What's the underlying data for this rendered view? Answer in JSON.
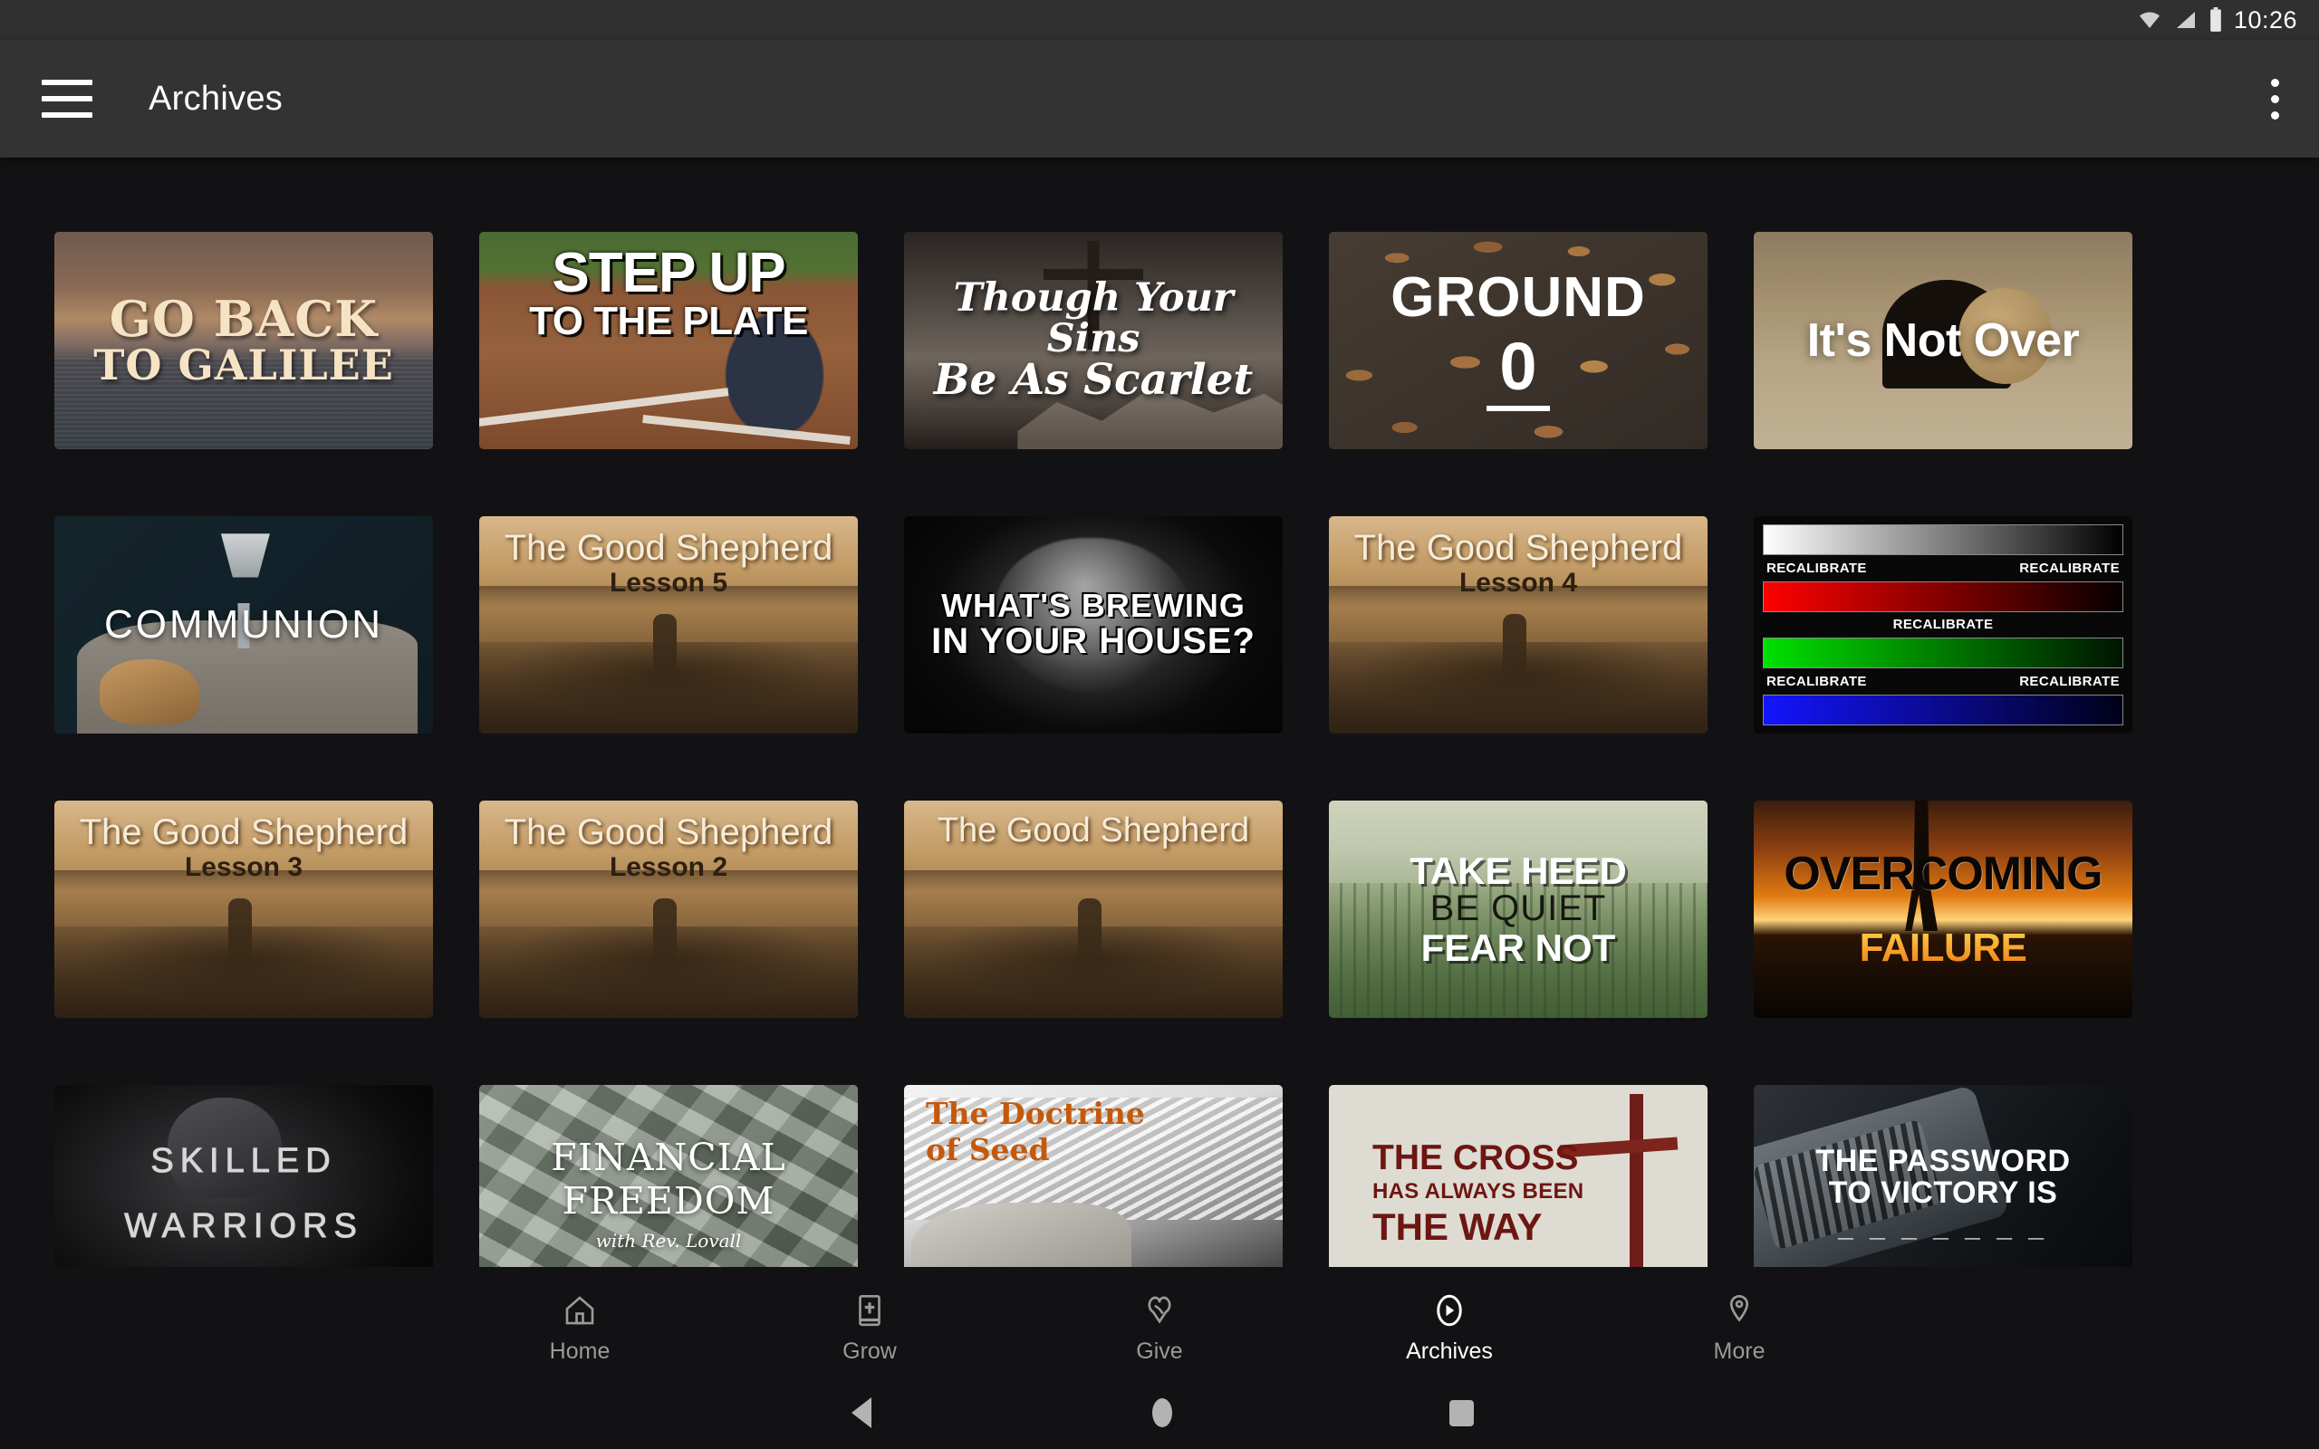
{
  "status_bar": {
    "time": "10:26",
    "icons": [
      "wifi-icon",
      "cell-signal-icon",
      "battery-icon"
    ]
  },
  "app_bar": {
    "menu_icon": "hamburger-menu-icon",
    "title": "Archives",
    "overflow_icon": "overflow-menu-icon"
  },
  "grid": {
    "tiles": [
      {
        "id": "go-back-to-galilee",
        "lines": [
          "GO BACK",
          "TO GALILEE"
        ],
        "style": "sunset lake, cream serif text"
      },
      {
        "id": "step-up-to-the-plate",
        "lines": [
          "STEP UP",
          "TO THE PLATE"
        ],
        "style": "baseball home plate"
      },
      {
        "id": "though-your-sins-be-as-scarlet",
        "lines": [
          "Though Your Sins",
          "Be As Scarlet"
        ],
        "style": "cross on rocky hill, script"
      },
      {
        "id": "ground-0",
        "lines": [
          "GROUND",
          "0"
        ],
        "style": "leaves on soil"
      },
      {
        "id": "its-not-over",
        "lines": [
          "It's Not Over"
        ],
        "style": "empty tomb"
      },
      {
        "id": "communion",
        "lines": [
          "COMMUNION"
        ],
        "style": "chalice and bread"
      },
      {
        "id": "the-good-shepherd-lesson-5",
        "lines": [
          "The Good Shepherd",
          "Lesson 5"
        ],
        "style": "sepia shepherd and flock"
      },
      {
        "id": "whats-brewing-in-your-house",
        "lines": [
          "WHAT'S BREWING",
          "IN YOUR HOUSE?"
        ],
        "style": "smoky brain on black"
      },
      {
        "id": "the-good-shepherd-lesson-4",
        "lines": [
          "The Good Shepherd",
          "Lesson 4"
        ],
        "style": "sepia shepherd and flock"
      },
      {
        "id": "recalibrate",
        "lines": [
          "RECALIBRATE"
        ],
        "style": "color calibration bars"
      },
      {
        "id": "the-good-shepherd-lesson-3",
        "lines": [
          "The Good Shepherd",
          "Lesson 3"
        ],
        "style": "sepia shepherd and flock"
      },
      {
        "id": "the-good-shepherd-lesson-2",
        "lines": [
          "The Good Shepherd",
          "Lesson 2"
        ],
        "style": "sepia shepherd and flock"
      },
      {
        "id": "the-good-shepherd",
        "lines": [
          "The Good Shepherd"
        ],
        "style": "sepia shepherd and flock"
      },
      {
        "id": "take-heed-be-quiet-fear-not",
        "lines": [
          "TAKE HEED",
          "BE QUIET",
          "FEAR NOT"
        ],
        "style": "misty green forest"
      },
      {
        "id": "overcoming-failure",
        "lines": [
          "OVERCOMING",
          "FAILURE"
        ],
        "style": "sunset silhouette"
      },
      {
        "id": "skilled-warriors",
        "lines": [
          "SKILLED",
          "WARRIORS"
        ],
        "style": "dark armored warrior"
      },
      {
        "id": "financial-freedom",
        "lines": [
          "FINANCIAL",
          "FREEDOM",
          "with Rev. Lovall"
        ],
        "style": "dollar bills"
      },
      {
        "id": "the-doctrine-of-seed",
        "lines": [
          "The Doctrine",
          "of Seed"
        ],
        "style": "black and white wheat and seed sack"
      },
      {
        "id": "the-cross-has-always-been-the-way",
        "lines": [
          "THE CROSS",
          "HAS ALWAYS BEEN",
          "THE WAY"
        ],
        "style": "beige with wooden cross"
      },
      {
        "id": "the-password-to-victory-is",
        "lines": [
          "THE PASSWORD",
          "TO VICTORY IS",
          "_ _ _ _ _ _ _"
        ],
        "style": "combination lock"
      }
    ],
    "recalibrate_tile": {
      "label": "RECALIBRATE",
      "bars": [
        "grayscale",
        "red",
        "green",
        "blue"
      ],
      "labels_row1": [
        "RECALIBRATE",
        "RECALIBRATE"
      ],
      "labels_row2": [
        "RECALIBRATE"
      ],
      "labels_row3": [
        "RECALIBRATE",
        "RECALIBRATE"
      ]
    }
  },
  "bottom_nav": {
    "items": [
      {
        "label": "Home",
        "icon": "house-icon",
        "active": false
      },
      {
        "label": "Grow",
        "icon": "bible-book-icon",
        "active": false
      },
      {
        "label": "Give",
        "icon": "giving-hands-icon",
        "active": false
      },
      {
        "label": "Archives",
        "icon": "play-circle-icon",
        "active": true
      },
      {
        "label": "More",
        "icon": "location-pin-icon",
        "active": false
      }
    ]
  },
  "system_nav": {
    "back": "back-triangle-icon",
    "home": "home-circle-icon",
    "recents": "recents-square-icon"
  },
  "colors": {
    "background": "#121214",
    "app_bar": "#333334",
    "status_bar": "#303030",
    "text_primary": "#ffffff",
    "text_inactive": "#9a9a9a"
  }
}
